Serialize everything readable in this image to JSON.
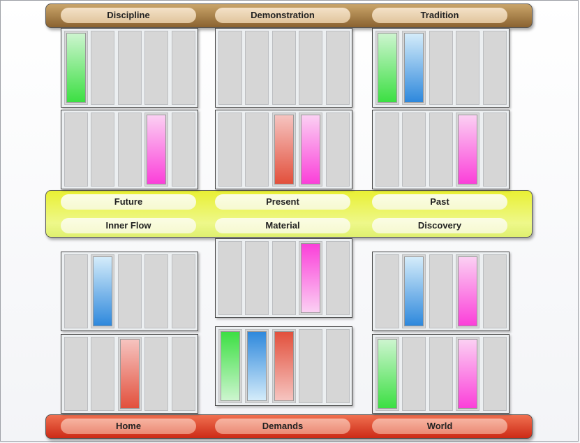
{
  "top_band": {
    "labels": [
      "Discipline",
      "Demonstration",
      "Tradition"
    ]
  },
  "middle_band": {
    "row1": [
      "Future",
      "Present",
      "Past"
    ],
    "row2": [
      "Inner Flow",
      "Material",
      "Discovery"
    ]
  },
  "bottom_band": {
    "labels": [
      "Home",
      "Demands",
      "World"
    ]
  },
  "colors": {
    "green": "#3cdf43",
    "blue": "#2e88dc",
    "red": "#e2503c",
    "pink": "#fb3fd9",
    "empty_slot": "#d6d6d6"
  },
  "grid": [
    {
      "column": 1,
      "row": 1,
      "slots": [
        "green-up",
        "empty",
        "empty",
        "empty",
        "empty"
      ]
    },
    {
      "column": 2,
      "row": 1,
      "slots": [
        "empty",
        "empty",
        "empty",
        "empty",
        "empty"
      ]
    },
    {
      "column": 3,
      "row": 1,
      "slots": [
        "green-up",
        "blue-up",
        "empty",
        "empty",
        "empty"
      ]
    },
    {
      "column": 1,
      "row": 2,
      "slots": [
        "empty",
        "empty",
        "empty",
        "pink-up",
        "empty"
      ]
    },
    {
      "column": 2,
      "row": 2,
      "slots": [
        "empty",
        "empty",
        "red-up",
        "pink-up",
        "empty"
      ]
    },
    {
      "column": 3,
      "row": 2,
      "slots": [
        "empty",
        "empty",
        "empty",
        "pink-up",
        "empty"
      ]
    },
    {
      "column": 1,
      "row": 3,
      "slots": [
        "empty",
        "blue-up",
        "empty",
        "empty",
        "empty"
      ]
    },
    {
      "column": 2,
      "row": 3,
      "slots": [
        "empty",
        "empty",
        "empty",
        "pink-down",
        "empty"
      ]
    },
    {
      "column": 3,
      "row": 3,
      "slots": [
        "empty",
        "blue-up",
        "empty",
        "pink-up",
        "empty"
      ]
    },
    {
      "column": 1,
      "row": 4,
      "slots": [
        "empty",
        "empty",
        "red-up",
        "empty",
        "empty"
      ]
    },
    {
      "column": 2,
      "row": 4,
      "slots": [
        "green-down",
        "blue-down",
        "red-down",
        "empty",
        "empty"
      ]
    },
    {
      "column": 3,
      "row": 4,
      "slots": [
        "green-up",
        "empty",
        "empty",
        "pink-up",
        "empty"
      ]
    }
  ]
}
